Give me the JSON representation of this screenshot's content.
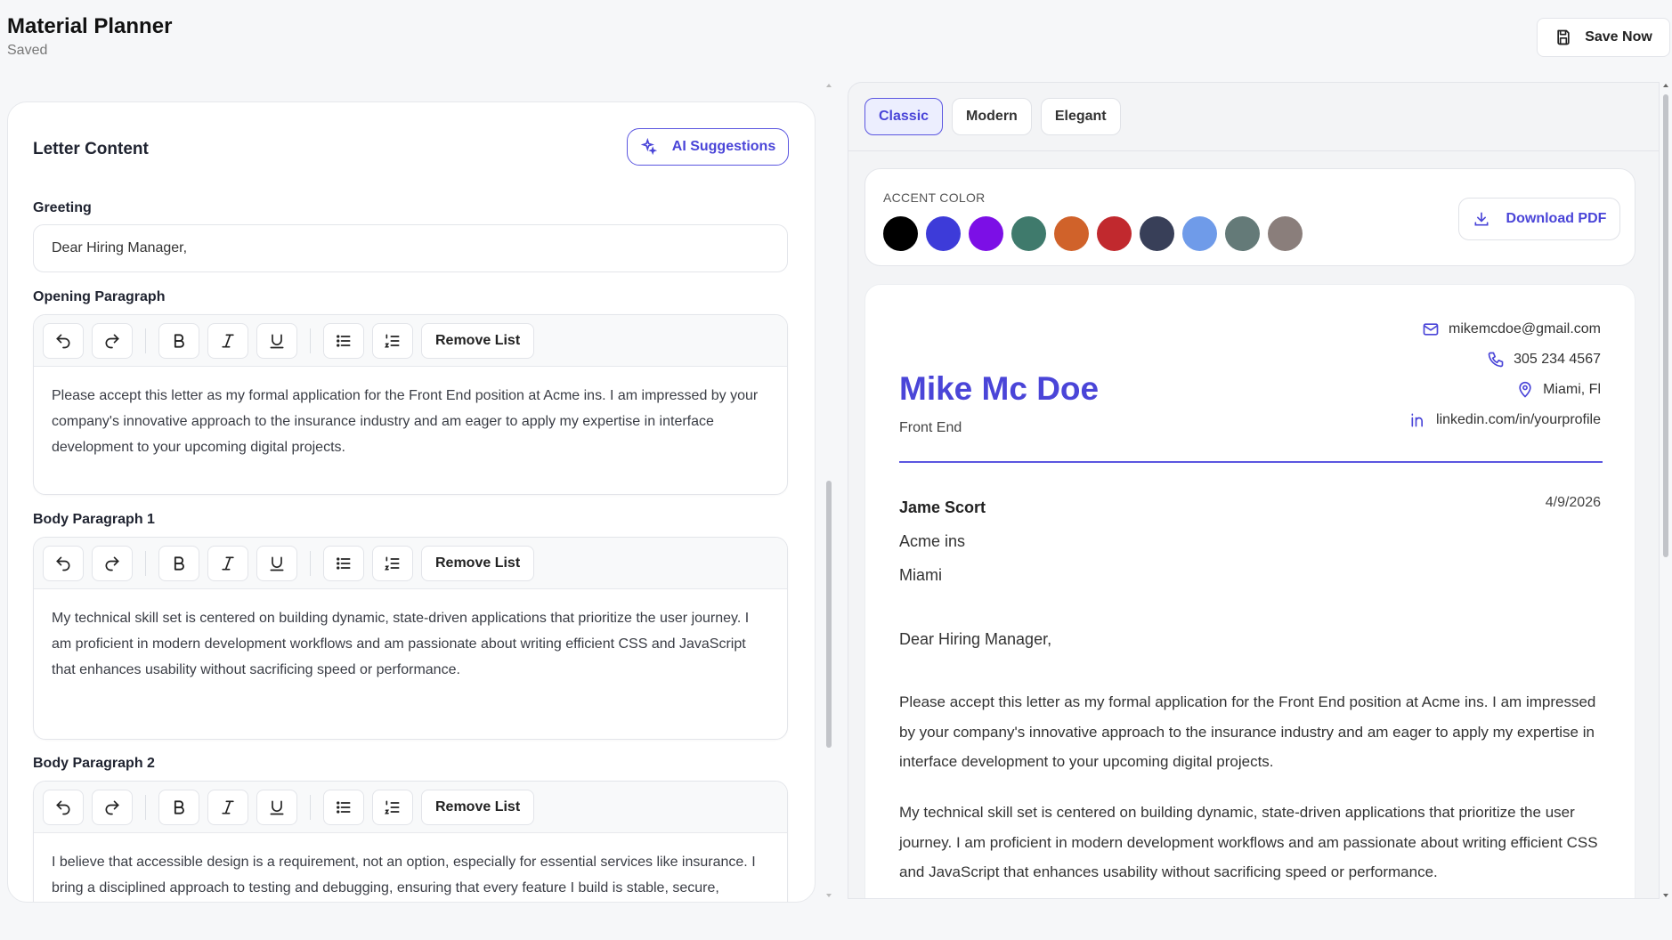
{
  "header": {
    "title": "Material Planner",
    "status": "Saved",
    "save_label": "Save Now"
  },
  "left": {
    "section_title": "Letter Content",
    "ai_label": "AI Suggestions",
    "greeting_label": "Greeting",
    "greeting_value": "Dear Hiring Manager,",
    "remove_list_label": "Remove List",
    "editors": [
      {
        "label": "Opening Paragraph",
        "text": "Please accept this letter as my formal application for the Front End position at Acme ins. I am impressed by your company's innovative approach to the insurance industry and am eager to apply my expertise in interface development to your upcoming digital projects."
      },
      {
        "label": "Body Paragraph 1",
        "text": "My technical skill set is centered on building dynamic, state-driven applications that prioritize the user journey. I am proficient in modern development workflows and am passionate about writing efficient CSS and JavaScript that enhances usability without sacrificing speed or performance."
      },
      {
        "label": "Body Paragraph 2",
        "text": "I believe that accessible design is a requirement, not an option, especially for essential services like insurance. I bring a disciplined approach to testing and debugging, ensuring that every feature I build is stable, secure,"
      }
    ]
  },
  "right": {
    "tabs": [
      {
        "label": "Classic"
      },
      {
        "label": "Modern"
      },
      {
        "label": "Elegant"
      }
    ],
    "accent_label": "ACCENT COLOR",
    "accent_colors": [
      "#000000",
      "#3d3bd9",
      "#7c0fe6",
      "#3f7a6c",
      "#d0622a",
      "#c1292e",
      "#383f58",
      "#6f9be9",
      "#647a78",
      "#8a7e7b"
    ],
    "download_label": "Download PDF",
    "letter": {
      "name": "Mike Mc Doe",
      "role": "Front End",
      "email": "mikemcdoe@gmail.com",
      "phone": "305 234 4567",
      "location": "Miami, Fl",
      "linkedin": "linkedin.com/in/yourprofile",
      "recipient": "Jame Scort",
      "date": "4/9/2026",
      "company": "Acme ins",
      "city": "Miami",
      "greeting": "Dear Hiring Manager,",
      "para1": "Please accept this letter as my formal application for the Front End position at Acme ins. I am impressed by your company's innovative approach to the insurance industry and am eager to apply my expertise in interface development to your upcoming digital projects.",
      "para2": "My technical skill set is centered on building dynamic, state-driven applications that prioritize the user journey. I am proficient in modern development workflows and am passionate about writing efficient CSS and JavaScript that enhances usability without sacrificing speed or performance."
    }
  }
}
